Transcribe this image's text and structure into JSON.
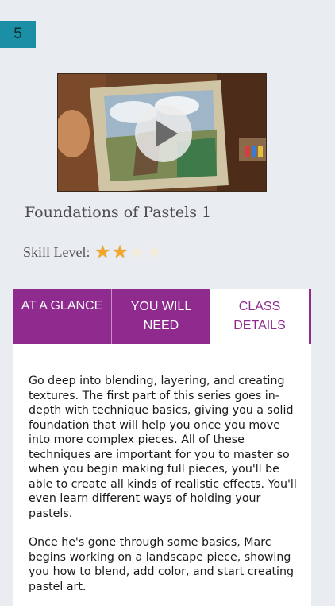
{
  "page_number": "5",
  "video": {
    "play_icon": "play-icon"
  },
  "course": {
    "title": "Foundations of Pastels 1"
  },
  "skill": {
    "label": "Skill Level:",
    "rating": 2,
    "max": 4,
    "star_color": "#f5a623"
  },
  "tabs": [
    {
      "label": "AT A GLANCE",
      "active": false
    },
    {
      "label": "YOU WILL NEED",
      "active": false
    },
    {
      "label": "CLASS DETAILS",
      "active": true
    }
  ],
  "details": {
    "paragraph1": "Go deep into blending, layering, and creating textures. The first part of this series goes in-depth with technique basics, giving you a solid foundation that will help you once you move into more complex pieces. All of these techniques are important for you to master so when you begin making full pieces, you'll be able to create all kinds of realistic effects. You'll even learn different ways of holding your pastels.",
    "paragraph2": "Once he's gone through some basics, Marc begins working on a landscape piece, showing you how to blend, add color, and start creating pastel art."
  },
  "colors": {
    "accent": "#8f2a8f",
    "badge": "#1b8fa6",
    "background": "#e9ecf0"
  }
}
